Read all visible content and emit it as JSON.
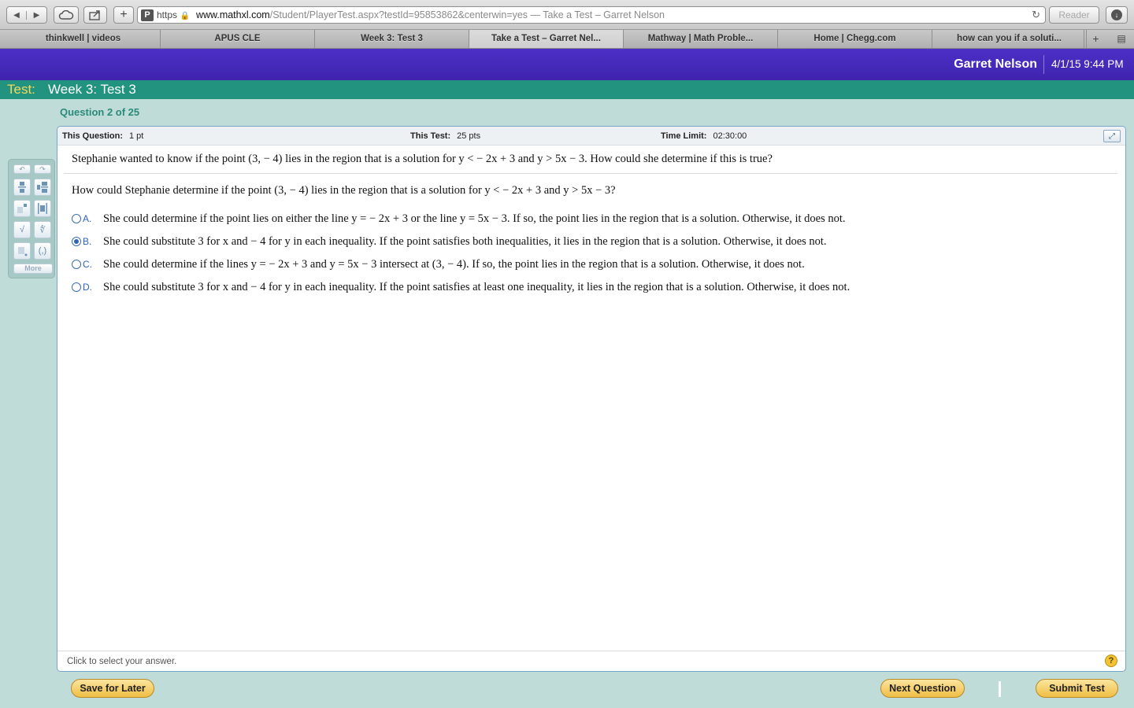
{
  "browser": {
    "url_scheme": "https",
    "url_host": "www.mathxl.com",
    "url_path": "/Student/PlayerTest.aspx?testId=95853862&centerwin=yes",
    "page_title": "— Take a Test – Garret Nelson",
    "reader_label": "Reader",
    "tabs": [
      {
        "label": "thinkwell | videos"
      },
      {
        "label": "APUS CLE"
      },
      {
        "label": "Week 3: Test 3"
      },
      {
        "label": "Take a Test – Garret Nel..."
      },
      {
        "label": "Mathway | Math Proble..."
      },
      {
        "label": "Home | Chegg.com"
      },
      {
        "label": "how can you if a soluti..."
      }
    ]
  },
  "header": {
    "user_name": "Garret Nelson",
    "date_time": "4/1/15 9:44 PM"
  },
  "test": {
    "prefix": "Test:",
    "name": "Week 3: Test 3",
    "question_count": "Question 2 of 25"
  },
  "info": {
    "this_question_label": "This Question:",
    "this_question_value": "1 pt",
    "this_test_label": "This Test:",
    "this_test_value": "25 pts",
    "time_limit_label": "Time Limit:",
    "time_limit_value": "02:30:00"
  },
  "question": {
    "statement": "Stephanie wanted to know if the point (3, − 4) lies in the region that is a solution for y < − 2x + 3 and y > 5x − 3. How could she determine if this is true?",
    "prompt": "How could Stephanie determine if the point (3, − 4) lies in the region that is a solution for y < − 2x + 3 and y > 5x − 3?",
    "selected": "B",
    "options": [
      {
        "letter": "A.",
        "text": "She could determine if the point lies on either the line y = − 2x + 3 or the line y = 5x − 3. If so, the point lies in the region that is a solution. Otherwise, it does not."
      },
      {
        "letter": "B.",
        "text": "She could substitute 3 for x and − 4 for y in each inequality. If the point satisfies both inequalities, it lies in the region that is a solution. Otherwise, it does not."
      },
      {
        "letter": "C.",
        "text": "She could determine if the lines y = − 2x + 3 and y = 5x − 3 intersect at (3, − 4). If so, the point lies in the region that is a solution. Otherwise, it does not."
      },
      {
        "letter": "D.",
        "text": "She could substitute 3 for x and − 4 for y in each inequality. If the point satisfies at least one inequality, it lies in the region that is a solution. Otherwise, it does not."
      }
    ]
  },
  "palette": {
    "more_label": "More"
  },
  "footer": {
    "hint": "Click to select your answer.",
    "help_glyph": "?"
  },
  "buttons": {
    "save_later": "Save for Later",
    "next_question": "Next Question",
    "submit_test": "Submit Test"
  }
}
